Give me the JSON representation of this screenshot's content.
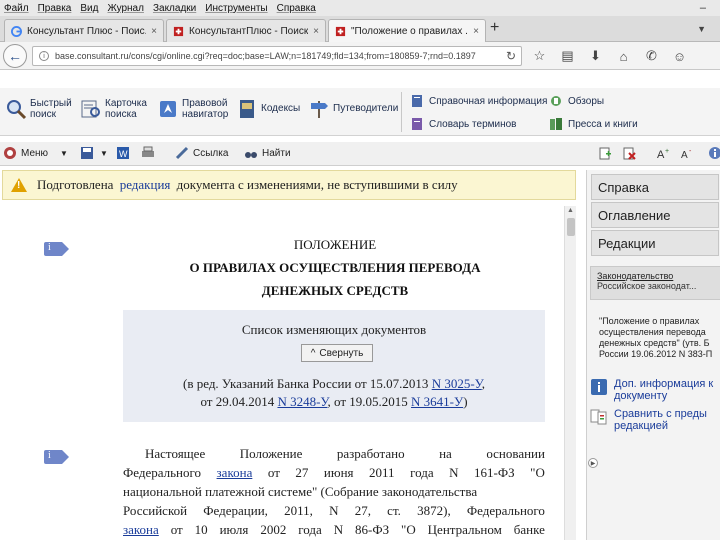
{
  "menubar": {
    "items": [
      "Файл",
      "Правка",
      "Вид",
      "Журнал",
      "Закладки",
      "Инструменты",
      "Справка"
    ],
    "minimize": "–"
  },
  "tabs": [
    {
      "label": "Консультант Плюс - Поис...",
      "close": "×",
      "favicon": "google-icon",
      "color": "#4285f4"
    },
    {
      "label": "КонсультантПлюс - Поиск ай...",
      "close": "×",
      "favicon": "consultant-icon",
      "color": "#c02020"
    },
    {
      "label": "\"Положение о правилах ...",
      "close": "×",
      "favicon": "consultant-icon",
      "color": "#c02020"
    }
  ],
  "newtab": "+",
  "tabdrop": "▼",
  "nav": {
    "back": "←",
    "info": "i",
    "url": "base.consultant.ru/cons/cgi/online.cgi?req=doc;base=LAW;n=181749;fld=134;from=180859-7;rnd=0.1897",
    "reload": "↻",
    "icons": [
      "☆",
      "▤",
      "⬇",
      "⌂",
      "✆",
      "☺"
    ]
  },
  "toolbar": {
    "quick_search": "Быстрый поиск",
    "card_search": "Карточка поиска",
    "legal_navigator": "Правовой навигатор",
    "codes": "Кодексы",
    "guides": "Путеводители",
    "reference_info": "Справочная информация",
    "reviews": "Обзоры",
    "dictionary": "Словарь терминов",
    "press": "Пресса и книги"
  },
  "toolbar2": {
    "menu": "Меню",
    "link": "Ссылка",
    "find": "Найти",
    "arrow_down": "▼"
  },
  "notice": {
    "before": "Подготовлена",
    "link": "редакция",
    "after": "документа с изменениями, не вступившими в силу"
  },
  "doc": {
    "title1": "ПОЛОЖЕНИЕ",
    "title2": "О ПРАВИЛАХ ОСУЩЕСТВЛЕНИЯ ПЕРЕВОДА",
    "title3": "ДЕНЕЖНЫХ СРЕДСТВ",
    "marker_letter": "i",
    "changes_title": "Список изменяющих документов",
    "collapse_label": "Свернуть",
    "collapse_icon": "^",
    "changes_line1_text": "(в ред. Указаний Банка России от 15.07.2013",
    "changes_line1_link": "N 3025-У",
    "changes_line1_end": ",",
    "changes_line2_a": "от 29.04.2014",
    "changes_line2_link1": "N 3248-У",
    "changes_line2_b": ", от 19.05.2015",
    "changes_line2_link2": "N 3641-У",
    "changes_line2_end": ")",
    "para_line1": [
      "Настоящее",
      "Положение",
      "разработано",
      "на",
      "основании"
    ],
    "para_line2_a": "Федерального",
    "para_line2_link": "закона",
    "para_line2_b": [
      "от",
      "27",
      "июня",
      "2011",
      "года",
      "N",
      "161-ФЗ",
      "\"О"
    ],
    "para_line3": "национальной платежной системе\" (Собрание законодательства",
    "para_line4": [
      "Российской",
      "Федерации,",
      "2011,",
      "N",
      "27,",
      "ст.",
      "3872),",
      "Федерального"
    ],
    "para_line5_link": "закона",
    "para_line5_b": [
      "от",
      "10",
      "июля",
      "2002",
      "года",
      "N",
      "86-ФЗ",
      "\"О",
      "Центральном",
      "банке"
    ]
  },
  "rpanel": {
    "tab_help": "Справка",
    "tab_contents": "Оглавление",
    "tab_editions": "Редакции",
    "law_head": "Законодательство",
    "law_sub": "Российское законодат...",
    "docname": "\"Положение о правилах осуществления перевода денежных средств\" (утв. Б России 19.06.2012 N 383-П",
    "more_info": "Доп. информация к документу",
    "compare": "Сравнить с преды редакцией"
  }
}
